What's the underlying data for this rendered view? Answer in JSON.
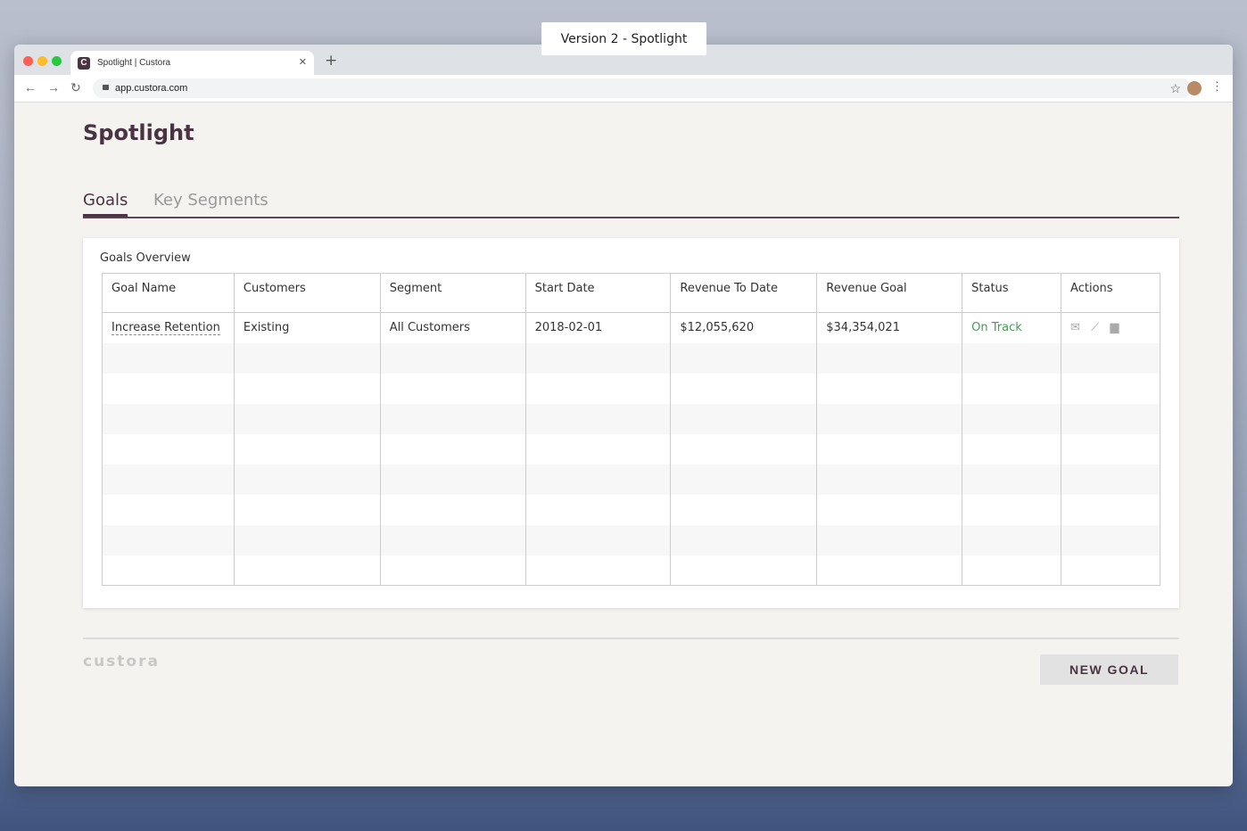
{
  "version_label": "Version 2 - Spotlight",
  "browser": {
    "tab_title": "Spotlight | Custora",
    "url": "app.custora.com"
  },
  "page": {
    "title": "Spotlight",
    "tabs": [
      "Goals",
      "Key Segments"
    ]
  },
  "card": {
    "title": "Goals Overview",
    "columns": [
      "Goal Name",
      "Customers",
      "Segment",
      "Start Date",
      "Revenue To Date",
      "Revenue Goal",
      "Status",
      "Actions"
    ],
    "rows": [
      {
        "goal_name": "Increase Retention",
        "customers": "Existing",
        "segment": "All Customers",
        "start_date": "2018-02-01",
        "revenue_to_date": "$12,055,620",
        "revenue_goal": "$34,354,021",
        "status": "On Track",
        "actions": [
          "mail-icon",
          "chart-icon",
          "archive-icon"
        ]
      }
    ]
  },
  "footer": {
    "logo": "custora",
    "new_goal": "NEW GOAL"
  },
  "colors": {
    "brand": "#4a3443",
    "status_on_track": "#4a9a5a"
  }
}
